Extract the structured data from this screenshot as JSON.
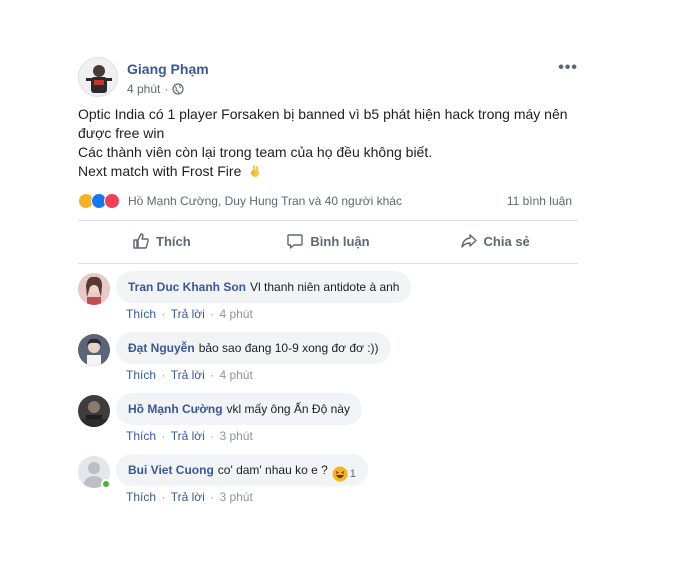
{
  "post": {
    "author": "Giang Phạm",
    "time": "4 phút",
    "text_lines": [
      "Optic India có 1 player Forsaken bị banned vì b5 phát hiện hack trong máy nên",
      "được free win",
      "Các thành viên còn lại trong team của họ đều không biết.",
      "Next match with Frost Fire"
    ],
    "reaction_names": "Hồ Mạnh Cường, Duy Hung Tran và 40 người khác",
    "comment_count": "11 bình luận",
    "colors": {
      "link": "#385898",
      "like": "#1877f2",
      "love": "#f33e58",
      "haha": "#f7b125"
    }
  },
  "actions": {
    "like": "Thích",
    "comment": "Bình luận",
    "share": "Chia sẻ"
  },
  "comments": [
    {
      "name": "Tran Duc Khanh Son",
      "text": "Vl thanh niên antidote à anh",
      "like": "Thích",
      "reply": "Trả lời",
      "time": "4 phút"
    },
    {
      "name": "Đạt Nguyễn",
      "text": "bảo sao đang 10-9 xong đơ đơ :))",
      "like": "Thích",
      "reply": "Trả lời",
      "time": "4 phút"
    },
    {
      "name": "Hồ Mạnh Cường",
      "text": "vkl mấy ông Ấn Độ này",
      "like": "Thích",
      "reply": "Trả lời",
      "time": "3 phút"
    },
    {
      "name": "Bui Viet Cuong",
      "text": "co' dam' nhau ko e ?",
      "like": "Thích",
      "reply": "Trả lời",
      "time": "3 phút",
      "reaction_count": "1"
    }
  ]
}
